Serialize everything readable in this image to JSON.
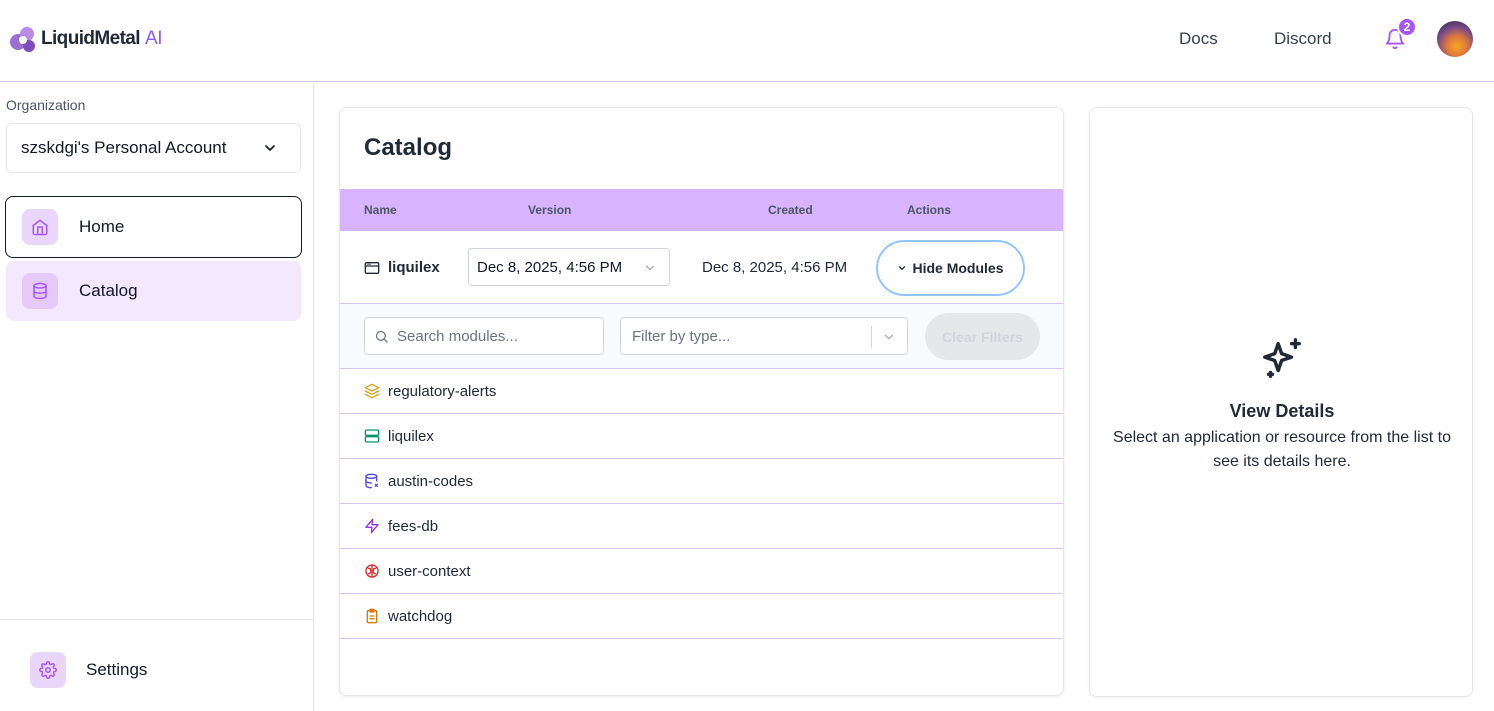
{
  "header": {
    "logo_text": "LiquidMetal",
    "logo_suffix": "AI",
    "nav": {
      "docs": "Docs",
      "discord": "Discord"
    },
    "notifications_count": "2"
  },
  "sidebar": {
    "org_label": "Organization",
    "org_value": "szskdgi's Personal Account",
    "items": [
      {
        "label": "Home",
        "icon": "home-icon"
      },
      {
        "label": "Catalog",
        "icon": "database-icon"
      }
    ],
    "settings_label": "Settings"
  },
  "catalog": {
    "title": "Catalog",
    "columns": [
      "Name",
      "Version",
      "Created",
      "Actions"
    ],
    "application": {
      "name": "liquilex",
      "version": "Dec 8, 2025, 4:56 PM",
      "created": "Dec 8, 2025, 4:56 PM",
      "action_label": "Hide Modules"
    },
    "filters": {
      "search_placeholder": "Search modules...",
      "type_placeholder": "Filter by type...",
      "clear_label": "Clear Filters"
    },
    "modules": [
      {
        "name": "regulatory-alerts",
        "icon": "layers-icon",
        "color": "#d4a017"
      },
      {
        "name": "liquilex",
        "icon": "server-icon",
        "color": "#059669"
      },
      {
        "name": "austin-codes",
        "icon": "database-icon",
        "color": "#4f46e5"
      },
      {
        "name": "fees-db",
        "icon": "lightning-icon",
        "color": "#9333ea"
      },
      {
        "name": "user-context",
        "icon": "brain-icon",
        "color": "#dc2626"
      },
      {
        "name": "watchdog",
        "icon": "clipboard-icon",
        "color": "#d97706"
      }
    ]
  },
  "details": {
    "title": "View Details",
    "text": "Select an application or resource from the list to see its details here."
  },
  "colors": {
    "accent": "#a855f7",
    "table_header": "#d8b4fe",
    "nav_active": "#f3e8fd"
  }
}
